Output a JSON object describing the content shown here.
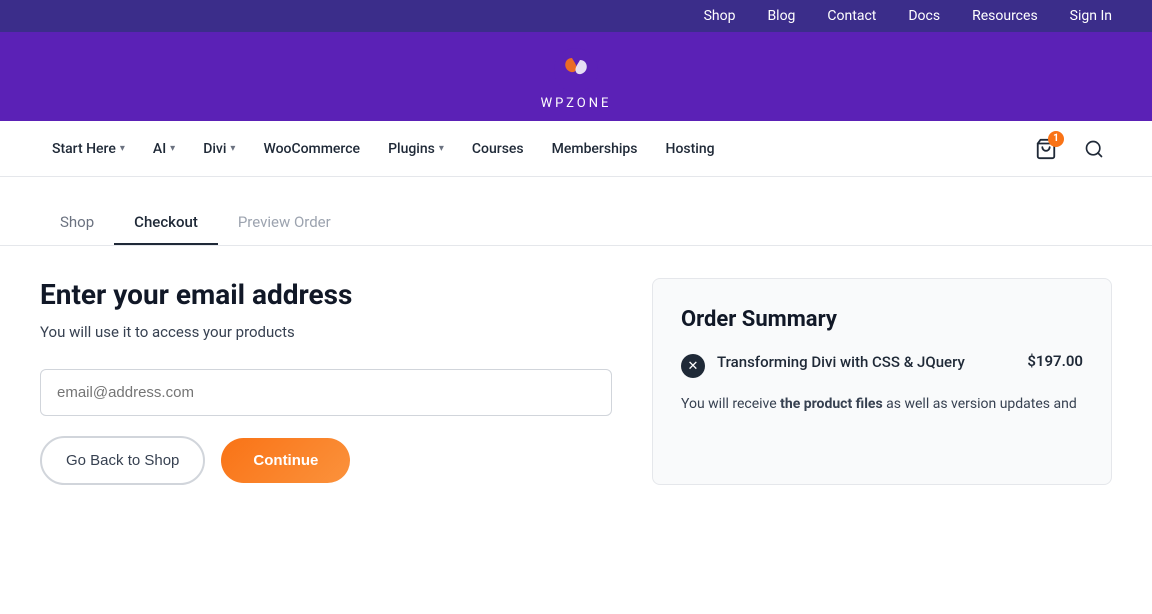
{
  "topbar": {
    "links": [
      "Shop",
      "Blog",
      "Contact",
      "Docs",
      "Resources",
      "Sign In"
    ]
  },
  "logo": {
    "text": "WPZONE"
  },
  "mainnav": {
    "items": [
      {
        "label": "Start Here",
        "hasDropdown": true
      },
      {
        "label": "AI",
        "hasDropdown": true
      },
      {
        "label": "Divi",
        "hasDropdown": true
      },
      {
        "label": "WooCommerce",
        "hasDropdown": false
      },
      {
        "label": "Plugins",
        "hasDropdown": true
      },
      {
        "label": "Courses",
        "hasDropdown": false
      },
      {
        "label": "Memberships",
        "hasDropdown": false
      },
      {
        "label": "Hosting",
        "hasDropdown": false
      }
    ],
    "cartCount": "1"
  },
  "tabs": [
    {
      "label": "Shop",
      "state": "visited"
    },
    {
      "label": "Checkout",
      "state": "active"
    },
    {
      "label": "Preview Order",
      "state": "inactive"
    }
  ],
  "emailSection": {
    "heading": "Enter your email address",
    "subtext": "You will use it to access your products",
    "inputPlaceholder": "email@address.com",
    "backButton": "Go Back to Shop",
    "continueButton": "Continue"
  },
  "orderSummary": {
    "title": "Order Summary",
    "items": [
      {
        "name": "Transforming Divi with CSS & JQuery",
        "price": "$197.00"
      }
    ],
    "note": "You will receive ",
    "noteStrong": "the product files",
    "noteEnd": " as well as version updates and"
  }
}
